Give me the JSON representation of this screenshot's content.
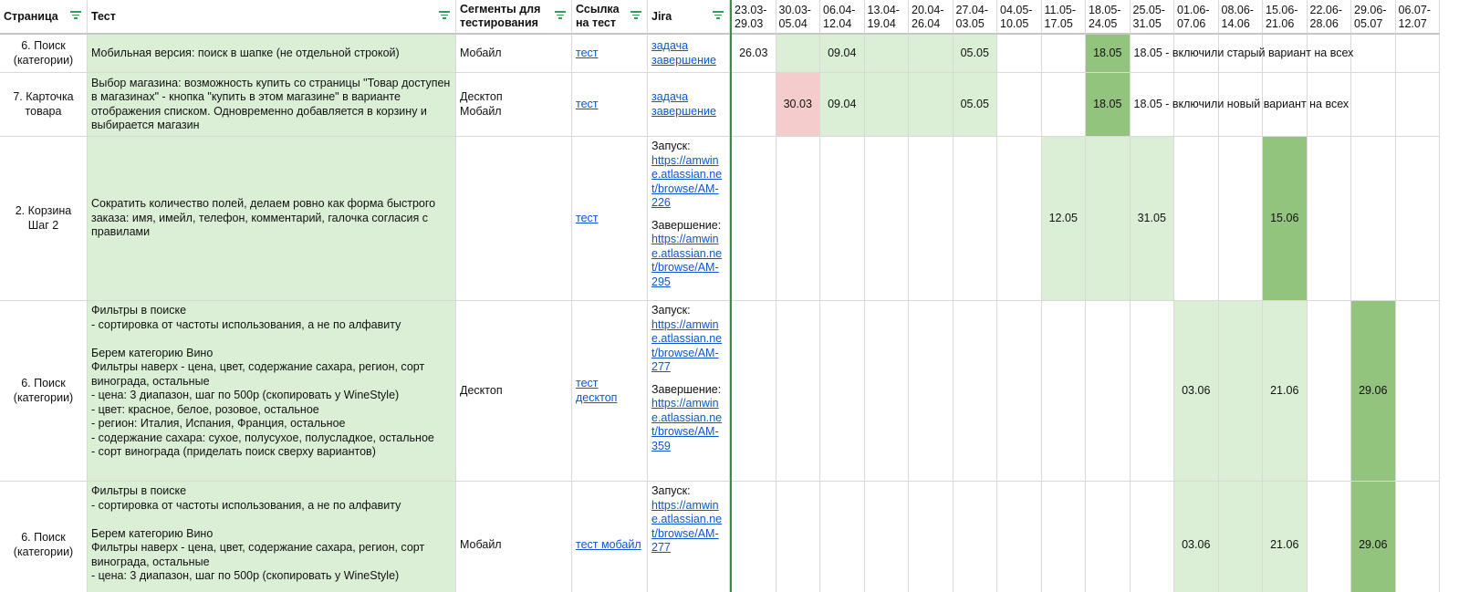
{
  "headers": {
    "page": "Страница",
    "test": "Тест",
    "segments": "Сегменты для тестирования",
    "link": "Ссылка на тест",
    "jira": "Jira"
  },
  "weeks": [
    "23.03-\n29.03",
    "30.03-\n05.04",
    "06.04-\n12.04",
    "13.04-\n19.04",
    "20.04-\n26.04",
    "27.04-\n03.05",
    "04.05-\n10.05",
    "11.05-\n17.05",
    "18.05-\n24.05",
    "25.05-\n31.05",
    "01.06-\n07.06",
    "08.06-\n14.06",
    "15.06-\n21.06",
    "22.06-\n28.06",
    "29.06-\n05.07",
    "06.07-\n12.07"
  ],
  "rows": [
    {
      "page": "6. Поиск\n(категории)",
      "test": "Мобильная версия: поиск в шапке (не отдельной строкой)",
      "segments": "Мобайл",
      "link": "тест",
      "jira": "задача\nзавершение",
      "cells": [
        "26.03",
        "",
        "09.04",
        "",
        "",
        "05.05",
        "",
        "",
        "18.05",
        "",
        "",
        "",
        "",
        "",
        "",
        ""
      ],
      "note": "18.05 - включили старый вариант на всех"
    },
    {
      "page": "7. Карточка\nтовара",
      "test": "Выбор магазина: возможность купить со страницы \"Товар доступен в магазинах\" - кнопка \"купить в этом магазине\" в варианте отображения списком. Одновременно добавляется в корзину и выбирается магазин",
      "segments": "Десктоп\nМобайл",
      "link": "тест",
      "jira": "задача\nзавершение",
      "cells": [
        "",
        "30.03",
        "09.04",
        "",
        "",
        "05.05",
        "",
        "",
        "18.05",
        "",
        "",
        "",
        "",
        "",
        "",
        ""
      ],
      "note": "18.05 - включили новый вариант на всех"
    },
    {
      "page": "2. Корзина\nШаг 2",
      "test": "Сократить количество полей, делаем ровно как форма быстрого заказа: имя, имейл, телефон, комментарий, галочка согласия с правилами",
      "segments": "",
      "link": "тест",
      "jira_label1": "Запуск:",
      "jira_link1": "https://amwin\ne.atlassian.ne\nt/browse/AM-\n226",
      "jira_label2": "Завершение:",
      "jira_link2": "https://amwin\ne.atlassian.ne\nt/browse/AM-\n295",
      "cells": [
        "",
        "",
        "",
        "",
        "",
        "",
        "",
        "12.05",
        "",
        "31.05",
        "",
        "",
        "15.06",
        "",
        "",
        ""
      ],
      "note": ""
    },
    {
      "page": "6. Поиск\n(категории)",
      "test": "Фильтры в поиске\n- сортировка от частоты использования, а не по алфавиту\n\nБерем категорию Вино\nФильтры наверх - цена, цвет, содержание сахара, регион, сорт винограда, остальные\n- цена: 3 диапазон, шаг по 500р (скопировать у WineStyle)\n- цвет: красное, белое, розовое, остальное\n- регион: Италия, Испания, Франция, остальное\n- содержание сахара: сухое, полусухое, полусладкое, остальное\n- сорт винограда (приделать поиск сверху вариантов)",
      "segments": "Десктоп",
      "link": "тест\nдесктоп",
      "jira_label1": "Запуск:",
      "jira_link1": "https://amwin\ne.atlassian.ne\nt/browse/AM-\n277",
      "jira_label2": "Завершение:",
      "jira_link2": "https://amwin\ne.atlassian.ne\nt/browse/AM-\n359",
      "cells": [
        "",
        "",
        "",
        "",
        "",
        "",
        "",
        "",
        "",
        "",
        "03.06",
        "",
        "21.06",
        "",
        "29.06",
        ""
      ],
      "note": ""
    },
    {
      "page": "6. Поиск\n(категории)",
      "test": "Фильтры в поиске\n- сортировка от частоты использования, а не по алфавиту\n\nБерем категорию Вино\nФильтры наверх - цена, цвет, содержание сахара, регион, сорт винограда, остальные\n- цена: 3 диапазон, шаг по 500р (скопировать у WineStyle)",
      "segments": "Мобайл",
      "link": "тест мобайл",
      "jira_label1": "Запуск:",
      "jira_link1": "https://amwin\ne.atlassian.ne\nt/browse/AM-\n277",
      "cells": [
        "",
        "",
        "",
        "",
        "",
        "",
        "",
        "",
        "",
        "",
        "03.06",
        "",
        "21.06",
        "",
        "29.06",
        ""
      ],
      "note": ""
    }
  ]
}
